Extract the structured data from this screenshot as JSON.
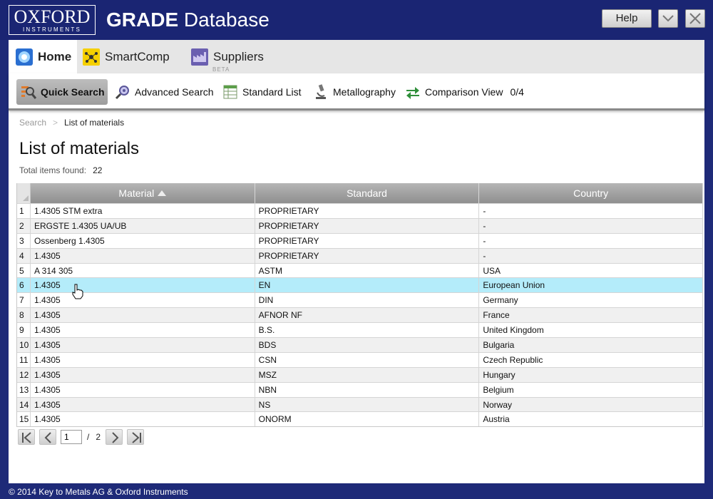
{
  "logo": {
    "line1": "OXFORD",
    "line2": "INSTRUMENTS"
  },
  "app_title": {
    "bold": "GRADE",
    "rest": "Database"
  },
  "window": {
    "help_label": "Help"
  },
  "topnav": {
    "tabs": [
      {
        "label": "Home",
        "icon": "home-globe-icon"
      },
      {
        "label": "SmartComp",
        "icon": "smartcomp-icon"
      },
      {
        "label": "Suppliers",
        "icon": "suppliers-icon",
        "badge": "BETA"
      }
    ]
  },
  "subnav": {
    "quick_search": "Quick Search",
    "advanced_search": "Advanced Search",
    "standard_list": "Standard List",
    "metallography": "Metallography",
    "comparison_view": "Comparison View",
    "comparison_count": "0/4"
  },
  "breadcrumb": {
    "root": "Search",
    "sep": ">",
    "current": "List of materials"
  },
  "page": {
    "title": "List of materials",
    "total_label": "Total items found:",
    "total_count": "22"
  },
  "table": {
    "headers": [
      "Material",
      "Standard",
      "Country"
    ],
    "sorted_column": "Material",
    "sort_direction": "ascending",
    "selected_row": 6,
    "rows": [
      [
        "1",
        "1.4305 STM extra",
        "PROPRIETARY",
        "-"
      ],
      [
        "2",
        "ERGSTE 1.4305 UA/UB",
        "PROPRIETARY",
        "-"
      ],
      [
        "3",
        "Ossenberg 1.4305",
        "PROPRIETARY",
        "-"
      ],
      [
        "4",
        "1.4305",
        "PROPRIETARY",
        "-"
      ],
      [
        "5",
        "A 314 305",
        "ASTM",
        "USA"
      ],
      [
        "6",
        "1.4305",
        "EN",
        "European Union"
      ],
      [
        "7",
        "1.4305",
        "DIN",
        "Germany"
      ],
      [
        "8",
        "1.4305",
        "AFNOR NF",
        "France"
      ],
      [
        "9",
        "1.4305",
        "B.S.",
        "United Kingdom"
      ],
      [
        "10",
        "1.4305",
        "BDS",
        "Bulgaria"
      ],
      [
        "11",
        "1.4305",
        "CSN",
        "Czech Republic"
      ],
      [
        "12",
        "1.4305",
        "MSZ",
        "Hungary"
      ],
      [
        "13",
        "1.4305",
        "NBN",
        "Belgium"
      ],
      [
        "14",
        "1.4305",
        "NS",
        "Norway"
      ],
      [
        "15",
        "1.4305",
        "ONORM",
        "Austria"
      ]
    ]
  },
  "pager": {
    "current_page": "1",
    "slash": "/",
    "total_pages": "2"
  },
  "footer": {
    "text": "© 2014 Key to Metals AG & Oxford Instruments"
  },
  "colors": {
    "brand": "#1a2573",
    "selected_row": "#b4ecfa",
    "header": "#a3a3a3"
  }
}
